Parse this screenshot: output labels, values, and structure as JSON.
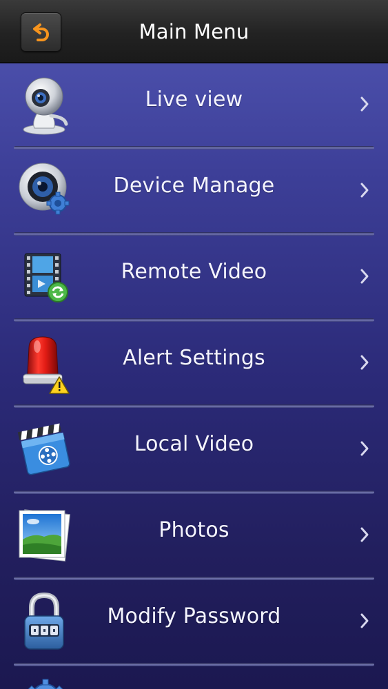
{
  "header": {
    "title": "Main Menu",
    "back_icon": "back-arrow-icon",
    "accent": "#f7941d"
  },
  "menu": {
    "items": [
      {
        "label": "Live view",
        "icon": "webcam-icon"
      },
      {
        "label": "Device Manage",
        "icon": "camera-gear-icon"
      },
      {
        "label": "Remote Video",
        "icon": "film-refresh-icon"
      },
      {
        "label": "Alert Settings",
        "icon": "alarm-siren-icon"
      },
      {
        "label": "Local Video",
        "icon": "clapperboard-icon"
      },
      {
        "label": "Photos",
        "icon": "photo-landscape-icon"
      },
      {
        "label": "Modify Password",
        "icon": "padlock-icon"
      }
    ],
    "chevron_icon": "chevron-right-icon",
    "partial_icon": "settings-gear-icon"
  },
  "colors": {
    "background_top": "#5257b4",
    "background_bottom": "#1b1850",
    "topbar": "#222222",
    "text": "#ffffff"
  }
}
